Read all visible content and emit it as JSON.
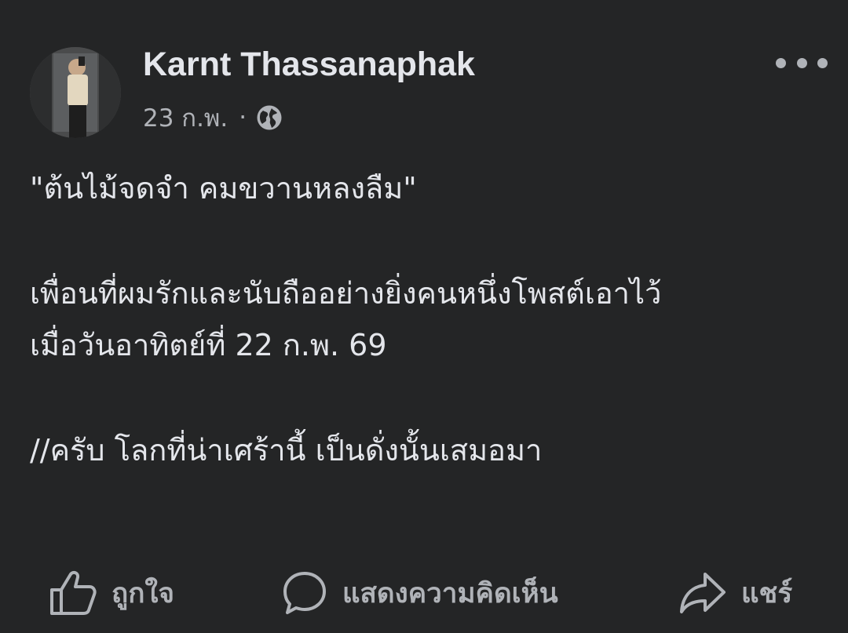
{
  "post": {
    "author_name": "Karnt Thassanaphak",
    "timestamp": "23 ก.พ.",
    "separator": "·",
    "privacy_icon": "globe-icon",
    "more_icon": "more-horizontal-icon",
    "lines": [
      "\"ต้นไม้จดจำ คมขวานหลงลืม\"",
      "เพื่อนที่ผมรักและนับถืออย่างยิ่งคนหนึ่งโพสต์เอาไว้",
      "เมื่อวันอาทิตย์ที่ 22 ก.พ. 69",
      "//ครับ โลกที่น่าเศร้านี้ เป็นดั่งนั้นเสมอมา"
    ]
  },
  "actions": {
    "like": {
      "label": "ถูกใจ",
      "icon": "thumbs-up-icon"
    },
    "comment": {
      "label": "แสดงความคิดเห็น",
      "icon": "comment-icon"
    },
    "share": {
      "label": "แชร์",
      "icon": "share-icon"
    }
  },
  "colors": {
    "background": "#242526",
    "primary_text": "#e4e6eb",
    "secondary_text": "#b0b3b8"
  }
}
